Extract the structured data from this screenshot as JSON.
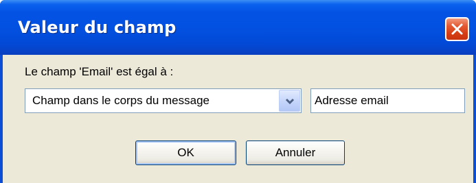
{
  "dialog": {
    "title": "Valeur du champ",
    "close_icon": "close-icon"
  },
  "form": {
    "label": "Le champ 'Email' est égal à :",
    "source_select": {
      "selected": "Champ dans le corps du message",
      "arrow_icon": "chevron-down-icon"
    },
    "field_name_value": "Adresse email"
  },
  "buttons": {
    "ok_label": "OK",
    "cancel_label": "Annuler"
  },
  "colors": {
    "titlebar": "#0452e4",
    "client_bg": "#ece9d8",
    "close_button": "#d63e14",
    "input_border": "#7f9db9"
  }
}
